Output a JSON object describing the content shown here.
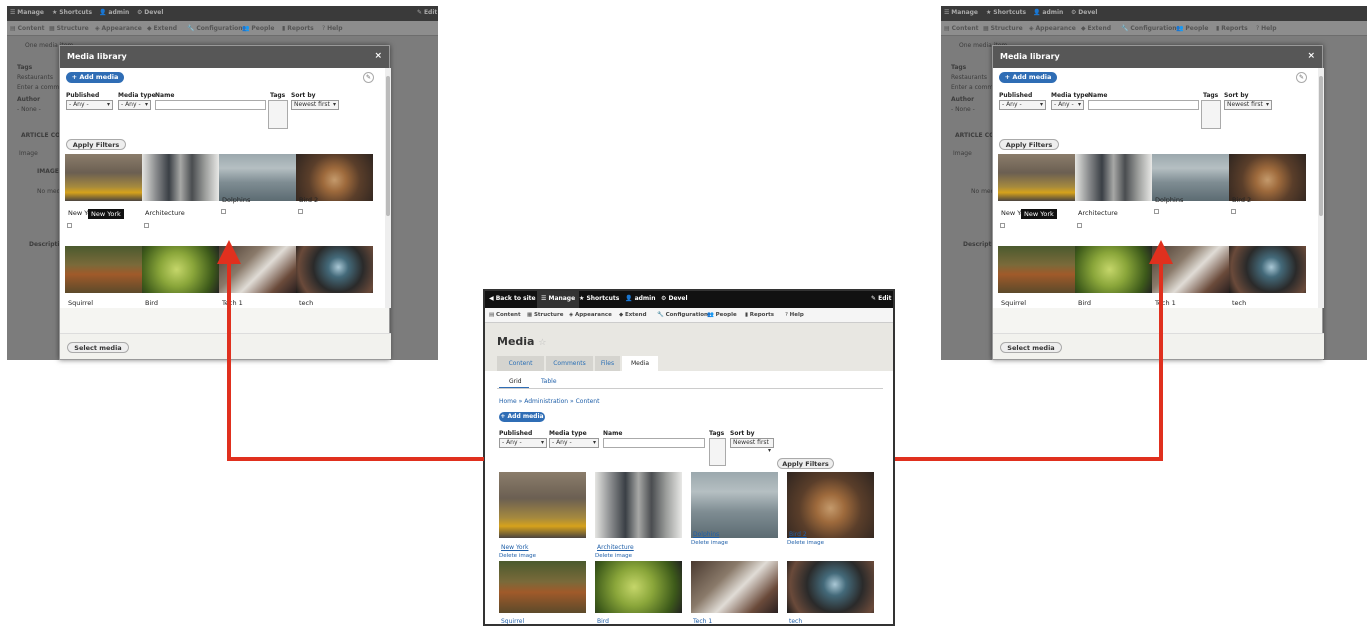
{
  "toolbar_top": {
    "manage": "Manage",
    "shortcuts": "Shortcuts",
    "admin": "admin",
    "devel": "Devel",
    "edit": "Edit",
    "back": "Back to site"
  },
  "toolbar_sec": {
    "content": "Content",
    "structure": "Structure",
    "appearance": "Appearance",
    "extend": "Extend",
    "configuration": "Configuration",
    "people": "People",
    "reports": "Reports",
    "help": "Help"
  },
  "underlay": {
    "one_media": "One media item",
    "tags": "Tags",
    "restaurants": "Restaurants",
    "enter": "Enter a comma",
    "author": "Author",
    "none": "- None -",
    "article": "ARTICLE CO",
    "image": "Image",
    "image_label": "IMAGE",
    "no_media": "No media",
    "description": "Description"
  },
  "modal": {
    "title": "Media library",
    "close": "×",
    "add_media": "+ Add media",
    "published": "Published",
    "published_value": "- Any -",
    "media_type": "Media type",
    "media_type_value": "- Any -",
    "name": "Name",
    "tags": "Tags",
    "sort_by": "Sort by",
    "sort_value": "Newest first",
    "apply": "Apply Filters",
    "select": "Select media",
    "tooltip": "New York",
    "items": [
      "New York",
      "Architecture",
      "Dolphins",
      "Bird 2",
      "Squirrel",
      "Bird",
      "Tech 1",
      "tech"
    ]
  },
  "center": {
    "page_title": "Media",
    "tabs": [
      "Content",
      "Comments",
      "Files",
      "Media"
    ],
    "subtabs": [
      "Grid",
      "Table"
    ],
    "breadcrumb": "Home » Administration » Content",
    "add_media": "+ Add media",
    "published": "Published",
    "published_value": "- Any -",
    "media_type": "Media type",
    "media_type_value": "- Any -",
    "name": "Name",
    "tags": "Tags",
    "sort_by": "Sort by",
    "sort_value": "Newest first",
    "apply": "Apply Filters",
    "items": [
      "New York",
      "Architecture",
      "Dolphins",
      "Bird 2",
      "Squirrel",
      "Bird",
      "Tech 1",
      "tech"
    ],
    "delete": "Delete image"
  },
  "colors": {
    "arrow": "#e0301e",
    "accent": "#2f6db5"
  }
}
